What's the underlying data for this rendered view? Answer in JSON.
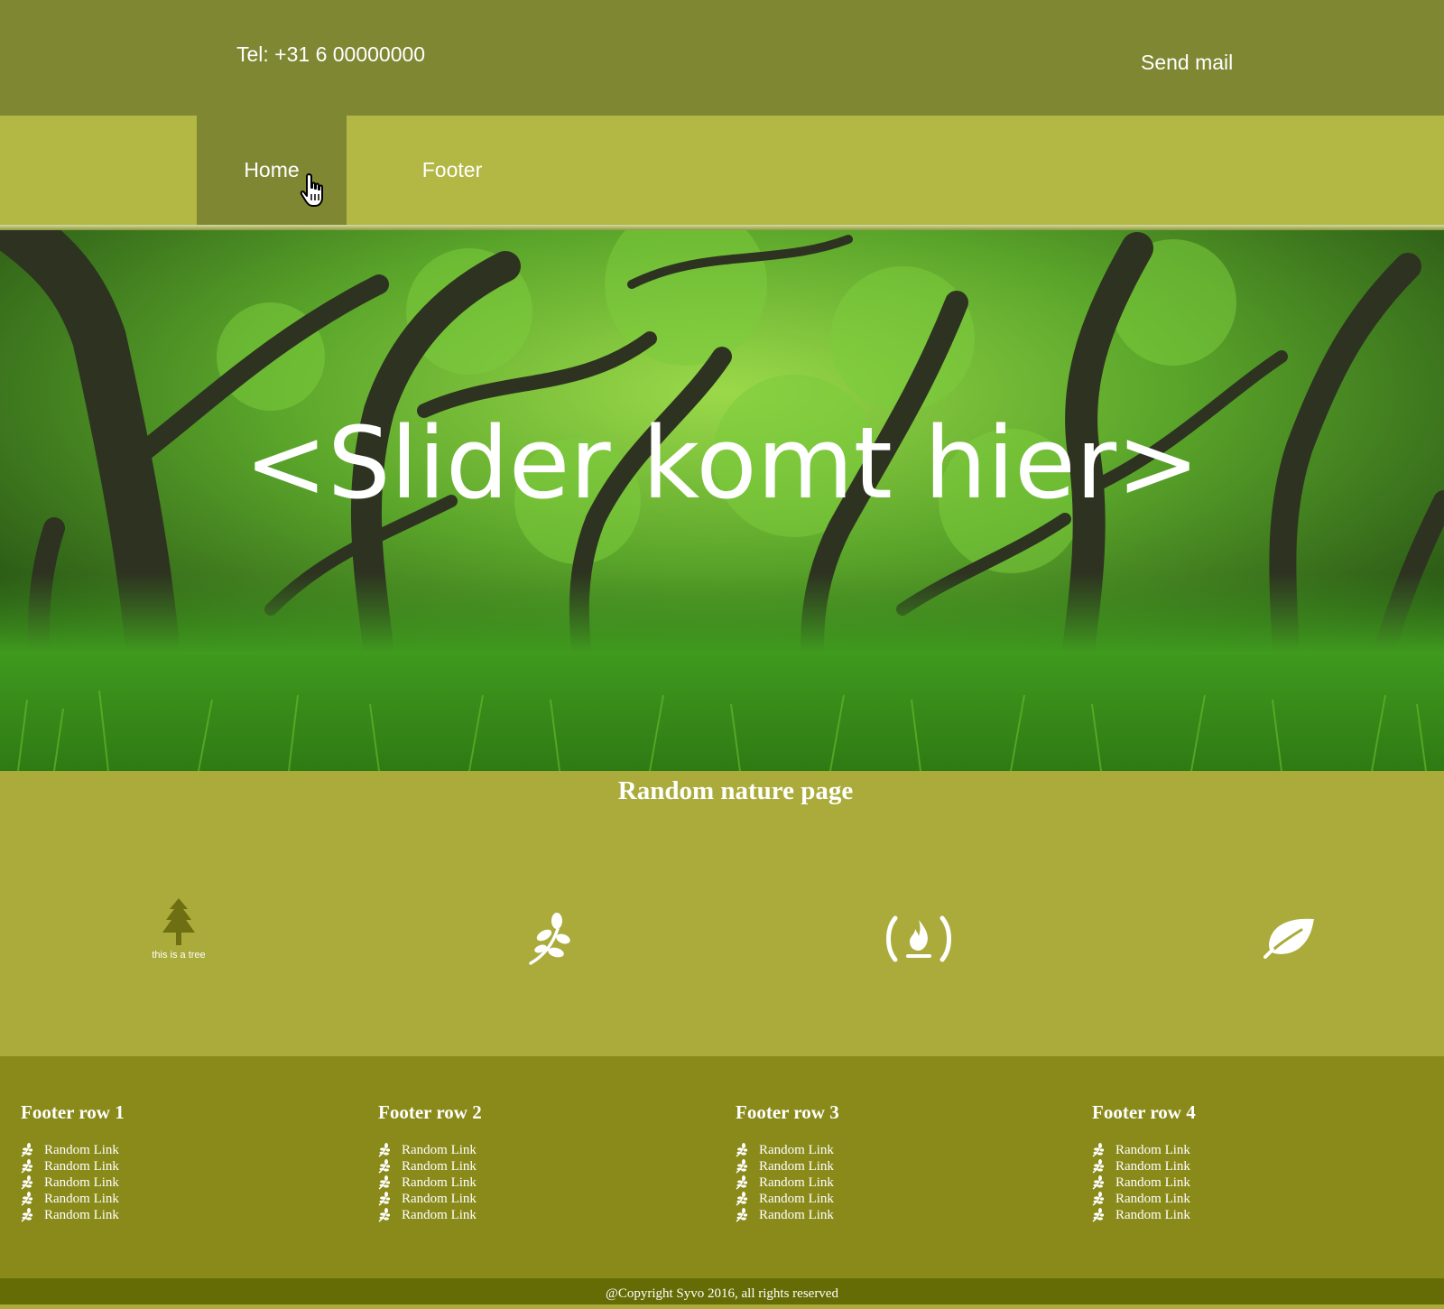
{
  "topbar": {
    "phone": "Tel: +31 6 00000000",
    "mail_link": "Send mail"
  },
  "nav": {
    "items": [
      {
        "label": "Home",
        "active": true
      },
      {
        "label": "Footer",
        "active": false
      }
    ]
  },
  "hero": {
    "text": "<Slider komt hier>",
    "image": "forest-photo"
  },
  "main": {
    "title": "Random nature page",
    "icons": [
      {
        "name": "tree-icon",
        "caption": "this is a tree"
      },
      {
        "name": "sprout-icon"
      },
      {
        "name": "campfire-icon"
      },
      {
        "name": "leaf-icon"
      }
    ]
  },
  "footer": {
    "columns": [
      {
        "title": "Footer row 1",
        "links": [
          "Random Link",
          "Random Link",
          "Random Link",
          "Random Link",
          "Random Link"
        ]
      },
      {
        "title": "Footer row 2",
        "links": [
          "Random Link",
          "Random Link",
          "Random Link",
          "Random Link",
          "Random Link"
        ]
      },
      {
        "title": "Footer row 3",
        "links": [
          "Random Link",
          "Random Link",
          "Random Link",
          "Random Link",
          "Random Link"
        ]
      },
      {
        "title": "Footer row 4",
        "links": [
          "Random Link",
          "Random Link",
          "Random Link",
          "Random Link",
          "Random Link"
        ]
      }
    ],
    "copyright": "@Copyright Syvo 2016, all rights reserved"
  },
  "colors": {
    "topbar": "#7f8733",
    "navbar": "#b3b744",
    "body": "#aaab3a",
    "footer": "#8a8a1b",
    "copyright_bar": "#666c05"
  }
}
